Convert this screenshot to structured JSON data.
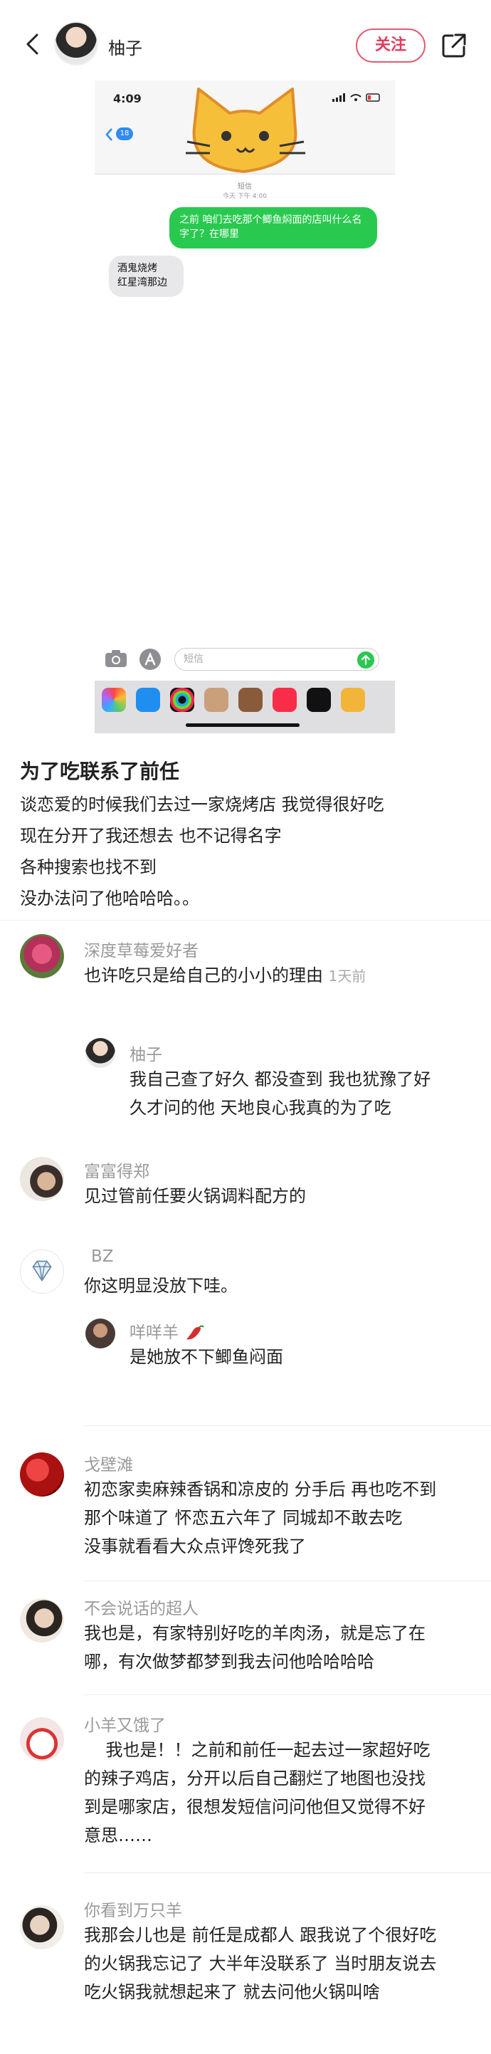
{
  "header": {
    "author": "柚子",
    "follow_label": "关注"
  },
  "phone": {
    "time": "4:09",
    "badge": "18",
    "contact": "短信",
    "timestamp": "今天 下午 4:00",
    "sent_message": "之前 咱们去吃那个鲫鱼焖面的店叫什么名字了？在哪里",
    "received_message": "酒鬼烧烤\n红星湾那边",
    "input_placeholder": "短信"
  },
  "post": {
    "title": "为了吃联系了前任",
    "lines": [
      "谈恋爱的时候我们去过一家烧烤店 我觉得很好吃",
      "现在分开了我还想去 也不记得名字",
      "各种搜索也找不到",
      "没办法问了他哈哈哈。。"
    ]
  },
  "comments": [
    {
      "name": "深度草莓爱好者",
      "text": "也许吃只是给自己的小小的理由",
      "time": "1天前"
    },
    {
      "name": "柚子",
      "lines": [
        "我自己查了好久 都没查到 我也犹豫了好",
        "久才问的他 天地良心我真的为了吃"
      ]
    },
    {
      "name": "富富得郑",
      "text": "见过管前任要火锅调料配方的"
    },
    {
      "name": "BZ",
      "text": "你这明显没放下哇。"
    },
    {
      "name": "咩咩羊",
      "text": "是她放不下鲫鱼闷面"
    },
    {
      "name": "戈壁滩",
      "lines": [
        "初恋家卖麻辣香锅和凉皮的 分手后 再也吃不到",
        "那个味道了 怀恋五六年了 同城却不敢去吃",
        "没事就看看大众点评馋死我了"
      ]
    },
    {
      "name": "不会说话的超人",
      "lines": [
        "我也是，有家特别好吃的羊肉汤，就是忘了在",
        "哪，有次做梦都梦到我去问他哈哈哈哈"
      ]
    },
    {
      "name": "小羊又饿了",
      "lines": [
        "    我也是！！之前和前任一起去过一家超好吃",
        "的辣子鸡店，分开以后自己翻烂了地图也没找",
        "到是哪家店，很想发短信问问他但又觉得不好",
        "意思……"
      ]
    },
    {
      "name": "你看到万只羊",
      "lines": [
        "我那会儿也是 前任是成都人 跟我说了个很好吃",
        "的火锅我忘记了 大半年没联系了 当时朋友说去",
        "吃火锅我就想起来了 就去问他火锅叫啥"
      ]
    }
  ],
  "colors": {
    "accent": "#e23b5a",
    "imessage_green": "#29c94f",
    "imessage_blue": "#2f8cf2"
  },
  "icons": [
    "back-arrow-icon",
    "share-icon",
    "camera-icon",
    "app-store-icon",
    "send-arrow-icon",
    "diamond-icon",
    "chili-icon"
  ]
}
